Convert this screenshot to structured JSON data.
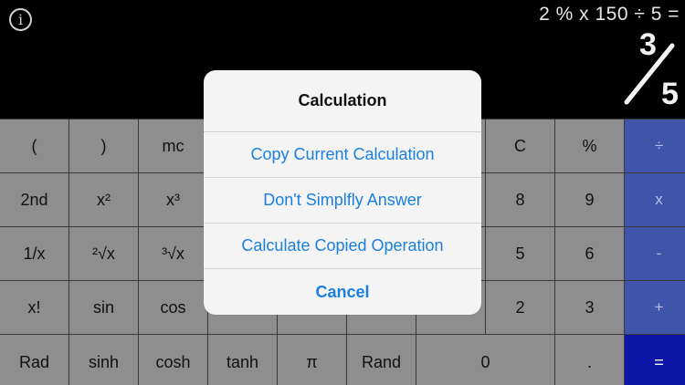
{
  "header": {
    "info_icon_glyph": "i",
    "expression": "2 % x 150 ÷ 5 =",
    "result_numerator": "3",
    "result_denominator": "5"
  },
  "keypad": {
    "rows": [
      [
        "(",
        ")",
        "mc",
        "",
        "",
        "",
        "",
        "C",
        "%",
        "÷"
      ],
      [
        "2nd",
        "x²",
        "x³",
        "",
        "",
        "",
        "",
        "8",
        "9",
        "x"
      ],
      [
        "1/x",
        "²√x",
        "³√x",
        "",
        "",
        "",
        "",
        "5",
        "6",
        "-"
      ],
      [
        "x!",
        "sin",
        "cos",
        "",
        "",
        "",
        "",
        "2",
        "3",
        "+"
      ],
      [
        "Rad",
        "sinh",
        "cosh",
        "tanh",
        "π",
        "Rand",
        "0",
        "",
        ".",
        "="
      ]
    ]
  },
  "dialog": {
    "title": "Calculation",
    "actions": [
      "Copy Current Calculation",
      "Don't Simplfly Answer",
      "Calculate Copied Operation"
    ],
    "cancel": "Cancel"
  },
  "colors": {
    "key_gray": "#8e8e8e",
    "operator_blue": "#3f55aa",
    "equals_blue": "#0c17a8",
    "action_blue": "#1a7fe0"
  }
}
